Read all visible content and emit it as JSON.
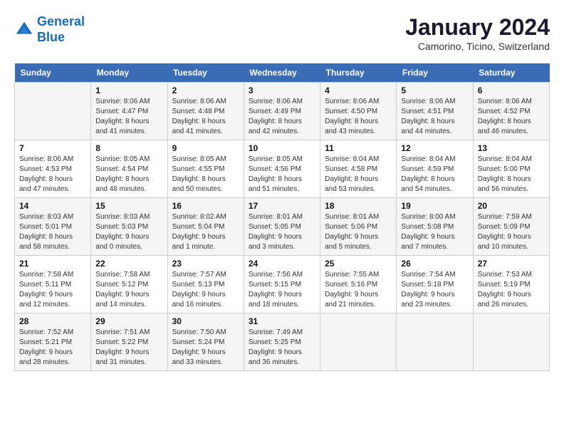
{
  "logo": {
    "line1": "General",
    "line2": "Blue"
  },
  "title": "January 2024",
  "subtitle": "Camorino, Ticino, Switzerland",
  "days_header": [
    "Sunday",
    "Monday",
    "Tuesday",
    "Wednesday",
    "Thursday",
    "Friday",
    "Saturday"
  ],
  "weeks": [
    [
      {
        "num": "",
        "sunrise": "",
        "sunset": "",
        "daylight": ""
      },
      {
        "num": "1",
        "sunrise": "Sunrise: 8:06 AM",
        "sunset": "Sunset: 4:47 PM",
        "daylight": "Daylight: 8 hours and 41 minutes."
      },
      {
        "num": "2",
        "sunrise": "Sunrise: 8:06 AM",
        "sunset": "Sunset: 4:48 PM",
        "daylight": "Daylight: 8 hours and 41 minutes."
      },
      {
        "num": "3",
        "sunrise": "Sunrise: 8:06 AM",
        "sunset": "Sunset: 4:49 PM",
        "daylight": "Daylight: 8 hours and 42 minutes."
      },
      {
        "num": "4",
        "sunrise": "Sunrise: 8:06 AM",
        "sunset": "Sunset: 4:50 PM",
        "daylight": "Daylight: 8 hours and 43 minutes."
      },
      {
        "num": "5",
        "sunrise": "Sunrise: 8:06 AM",
        "sunset": "Sunset: 4:51 PM",
        "daylight": "Daylight: 8 hours and 44 minutes."
      },
      {
        "num": "6",
        "sunrise": "Sunrise: 8:06 AM",
        "sunset": "Sunset: 4:52 PM",
        "daylight": "Daylight: 8 hours and 46 minutes."
      }
    ],
    [
      {
        "num": "7",
        "sunrise": "Sunrise: 8:06 AM",
        "sunset": "Sunset: 4:53 PM",
        "daylight": "Daylight: 8 hours and 47 minutes."
      },
      {
        "num": "8",
        "sunrise": "Sunrise: 8:05 AM",
        "sunset": "Sunset: 4:54 PM",
        "daylight": "Daylight: 8 hours and 48 minutes."
      },
      {
        "num": "9",
        "sunrise": "Sunrise: 8:05 AM",
        "sunset": "Sunset: 4:55 PM",
        "daylight": "Daylight: 8 hours and 50 minutes."
      },
      {
        "num": "10",
        "sunrise": "Sunrise: 8:05 AM",
        "sunset": "Sunset: 4:56 PM",
        "daylight": "Daylight: 8 hours and 51 minutes."
      },
      {
        "num": "11",
        "sunrise": "Sunrise: 8:04 AM",
        "sunset": "Sunset: 4:58 PM",
        "daylight": "Daylight: 8 hours and 53 minutes."
      },
      {
        "num": "12",
        "sunrise": "Sunrise: 8:04 AM",
        "sunset": "Sunset: 4:59 PM",
        "daylight": "Daylight: 8 hours and 54 minutes."
      },
      {
        "num": "13",
        "sunrise": "Sunrise: 8:04 AM",
        "sunset": "Sunset: 5:00 PM",
        "daylight": "Daylight: 8 hours and 56 minutes."
      }
    ],
    [
      {
        "num": "14",
        "sunrise": "Sunrise: 8:03 AM",
        "sunset": "Sunset: 5:01 PM",
        "daylight": "Daylight: 8 hours and 58 minutes."
      },
      {
        "num": "15",
        "sunrise": "Sunrise: 8:03 AM",
        "sunset": "Sunset: 5:03 PM",
        "daylight": "Daylight: 9 hours and 0 minutes."
      },
      {
        "num": "16",
        "sunrise": "Sunrise: 8:02 AM",
        "sunset": "Sunset: 5:04 PM",
        "daylight": "Daylight: 9 hours and 1 minute."
      },
      {
        "num": "17",
        "sunrise": "Sunrise: 8:01 AM",
        "sunset": "Sunset: 5:05 PM",
        "daylight": "Daylight: 9 hours and 3 minutes."
      },
      {
        "num": "18",
        "sunrise": "Sunrise: 8:01 AM",
        "sunset": "Sunset: 5:06 PM",
        "daylight": "Daylight: 9 hours and 5 minutes."
      },
      {
        "num": "19",
        "sunrise": "Sunrise: 8:00 AM",
        "sunset": "Sunset: 5:08 PM",
        "daylight": "Daylight: 9 hours and 7 minutes."
      },
      {
        "num": "20",
        "sunrise": "Sunrise: 7:59 AM",
        "sunset": "Sunset: 5:09 PM",
        "daylight": "Daylight: 9 hours and 10 minutes."
      }
    ],
    [
      {
        "num": "21",
        "sunrise": "Sunrise: 7:58 AM",
        "sunset": "Sunset: 5:11 PM",
        "daylight": "Daylight: 9 hours and 12 minutes."
      },
      {
        "num": "22",
        "sunrise": "Sunrise: 7:58 AM",
        "sunset": "Sunset: 5:12 PM",
        "daylight": "Daylight: 9 hours and 14 minutes."
      },
      {
        "num": "23",
        "sunrise": "Sunrise: 7:57 AM",
        "sunset": "Sunset: 5:13 PM",
        "daylight": "Daylight: 9 hours and 16 minutes."
      },
      {
        "num": "24",
        "sunrise": "Sunrise: 7:56 AM",
        "sunset": "Sunset: 5:15 PM",
        "daylight": "Daylight: 9 hours and 18 minutes."
      },
      {
        "num": "25",
        "sunrise": "Sunrise: 7:55 AM",
        "sunset": "Sunset: 5:16 PM",
        "daylight": "Daylight: 9 hours and 21 minutes."
      },
      {
        "num": "26",
        "sunrise": "Sunrise: 7:54 AM",
        "sunset": "Sunset: 5:18 PM",
        "daylight": "Daylight: 9 hours and 23 minutes."
      },
      {
        "num": "27",
        "sunrise": "Sunrise: 7:53 AM",
        "sunset": "Sunset: 5:19 PM",
        "daylight": "Daylight: 9 hours and 26 minutes."
      }
    ],
    [
      {
        "num": "28",
        "sunrise": "Sunrise: 7:52 AM",
        "sunset": "Sunset: 5:21 PM",
        "daylight": "Daylight: 9 hours and 28 minutes."
      },
      {
        "num": "29",
        "sunrise": "Sunrise: 7:51 AM",
        "sunset": "Sunset: 5:22 PM",
        "daylight": "Daylight: 9 hours and 31 minutes."
      },
      {
        "num": "30",
        "sunrise": "Sunrise: 7:50 AM",
        "sunset": "Sunset: 5:24 PM",
        "daylight": "Daylight: 9 hours and 33 minutes."
      },
      {
        "num": "31",
        "sunrise": "Sunrise: 7:49 AM",
        "sunset": "Sunset: 5:25 PM",
        "daylight": "Daylight: 9 hours and 36 minutes."
      },
      {
        "num": "",
        "sunrise": "",
        "sunset": "",
        "daylight": ""
      },
      {
        "num": "",
        "sunrise": "",
        "sunset": "",
        "daylight": ""
      },
      {
        "num": "",
        "sunrise": "",
        "sunset": "",
        "daylight": ""
      }
    ]
  ]
}
